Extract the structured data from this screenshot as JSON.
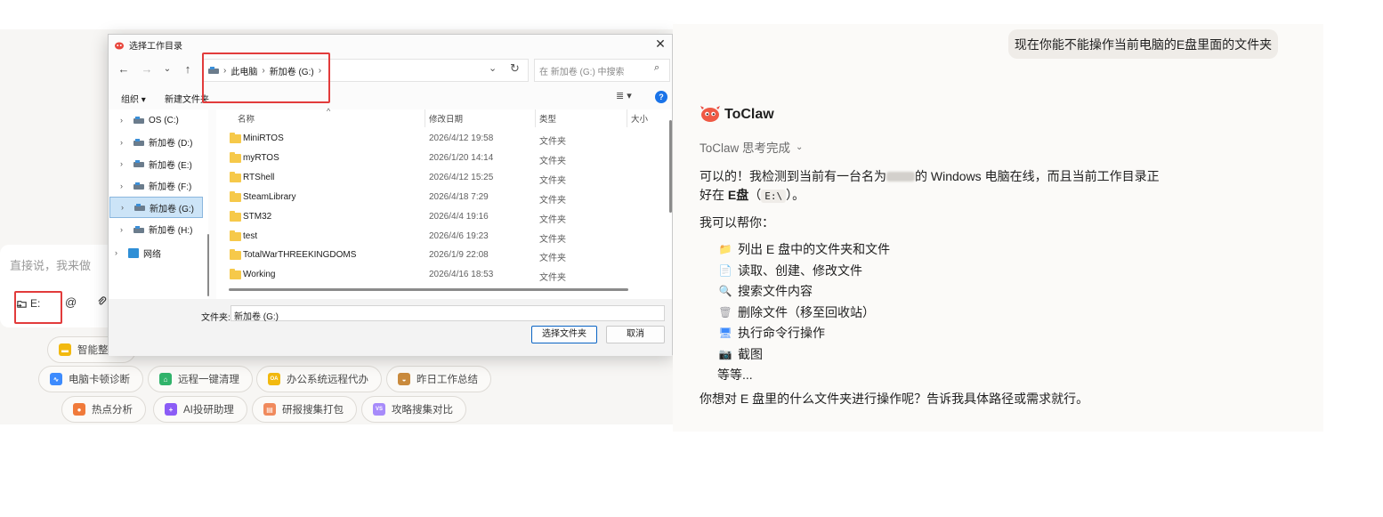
{
  "left_app": {
    "input_placeholder": "直接说，我来做",
    "dir_chip_label": "E:",
    "at_symbol": "@",
    "quick_actions": [
      {
        "label": "智能整",
        "icon": "folder-icon",
        "color": "#f2b90f"
      },
      {
        "label": "电脑卡顿诊断",
        "icon": "chart-icon",
        "color": "#3d8bfd"
      },
      {
        "label": "远程一键清理",
        "icon": "broom-icon",
        "color": "#31b36b"
      },
      {
        "label": "办公系统远程代办",
        "icon": "oa-icon",
        "color": "#f2b90f"
      },
      {
        "label": "昨日工作总结",
        "icon": "burger-icon",
        "color": "#c98a3d"
      },
      {
        "label": "热点分析",
        "icon": "fire-icon",
        "color": "#f07a3a"
      },
      {
        "label": "AI投研助理",
        "icon": "ai-icon",
        "color": "#8b5cf6"
      },
      {
        "label": "研报搜集打包",
        "icon": "box-icon",
        "color": "#f08a5d"
      },
      {
        "label": "攻略搜集对比",
        "icon": "vs-icon",
        "color": "#a78bfa"
      }
    ]
  },
  "dialog": {
    "title": "选择工作目录",
    "breadcrumb": [
      "此电脑",
      "新加卷 (G:)"
    ],
    "search_placeholder": "在 新加卷 (G:) 中搜索",
    "toolbar": {
      "organize": "组织 ▾",
      "new_folder": "新建文件夹"
    },
    "tree": [
      {
        "label": "OS (C:)",
        "selected": false,
        "kind": "drive"
      },
      {
        "label": "新加卷 (D:)",
        "selected": false,
        "kind": "drive"
      },
      {
        "label": "新加卷 (E:)",
        "selected": false,
        "kind": "drive"
      },
      {
        "label": "新加卷 (F:)",
        "selected": false,
        "kind": "drive"
      },
      {
        "label": "新加卷 (G:)",
        "selected": true,
        "kind": "drive"
      },
      {
        "label": "新加卷 (H:)",
        "selected": false,
        "kind": "drive"
      },
      {
        "label": "网络",
        "selected": false,
        "kind": "network"
      }
    ],
    "columns": {
      "name": "名称",
      "date": "修改日期",
      "type": "类型",
      "size": "大小"
    },
    "files": [
      {
        "name": "MiniRTOS",
        "date": "2026/4/12 19:58",
        "type": "文件夹"
      },
      {
        "name": "myRTOS",
        "date": "2026/1/20 14:14",
        "type": "文件夹"
      },
      {
        "name": "RTShell",
        "date": "2026/4/12 15:25",
        "type": "文件夹"
      },
      {
        "name": "SteamLibrary",
        "date": "2026/4/18 7:29",
        "type": "文件夹"
      },
      {
        "name": "STM32",
        "date": "2026/4/4 19:16",
        "type": "文件夹"
      },
      {
        "name": "test",
        "date": "2026/4/6 19:23",
        "type": "文件夹"
      },
      {
        "name": "TotalWarTHREEKINGDOMS",
        "date": "2026/1/9 22:08",
        "type": "文件夹"
      },
      {
        "name": "Working",
        "date": "2026/4/16 18:53",
        "type": "文件夹"
      }
    ],
    "folder_label": "文件夹:",
    "folder_value": "新加卷 (G:)",
    "select_button": "选择文件夹",
    "cancel_button": "取消"
  },
  "chat": {
    "user_message": "现在你能不能操作当前电脑的E盘里面的文件夹",
    "bot_name": "ToClaw",
    "think_status": "ToClaw 思考完成",
    "reply": {
      "p1_a": "可以的！我检测到当前有一台名为",
      "p1_b": "的 Windows 电脑在线，而且当前工作目录正",
      "p1_c": "好在 ",
      "p1_bold": "E盘",
      "p1_d": "（",
      "p1_code": "E:\\",
      "p1_e": "）。",
      "p2": "我可以帮你：",
      "items": [
        {
          "icon": "folder-icon",
          "text": "列出 E 盘中的文件夹和文件"
        },
        {
          "icon": "document-icon",
          "text": "读取、创建、修改文件"
        },
        {
          "icon": "magnifier-icon",
          "text": "搜索文件内容"
        },
        {
          "icon": "trash-icon",
          "text": "删除文件（移至回收站）"
        },
        {
          "icon": "monitor-icon",
          "text": "执行命令行操作"
        },
        {
          "icon": "camera-icon",
          "text": "截图"
        }
      ],
      "etc": "等等...",
      "p3": "你想对 E 盘里的什么文件夹进行操作呢？告诉我具体路径或需求就行。"
    }
  },
  "colors": {
    "highlight": "#e23b3b",
    "accent": "#0a64c4",
    "selection": "#cce4f7"
  }
}
